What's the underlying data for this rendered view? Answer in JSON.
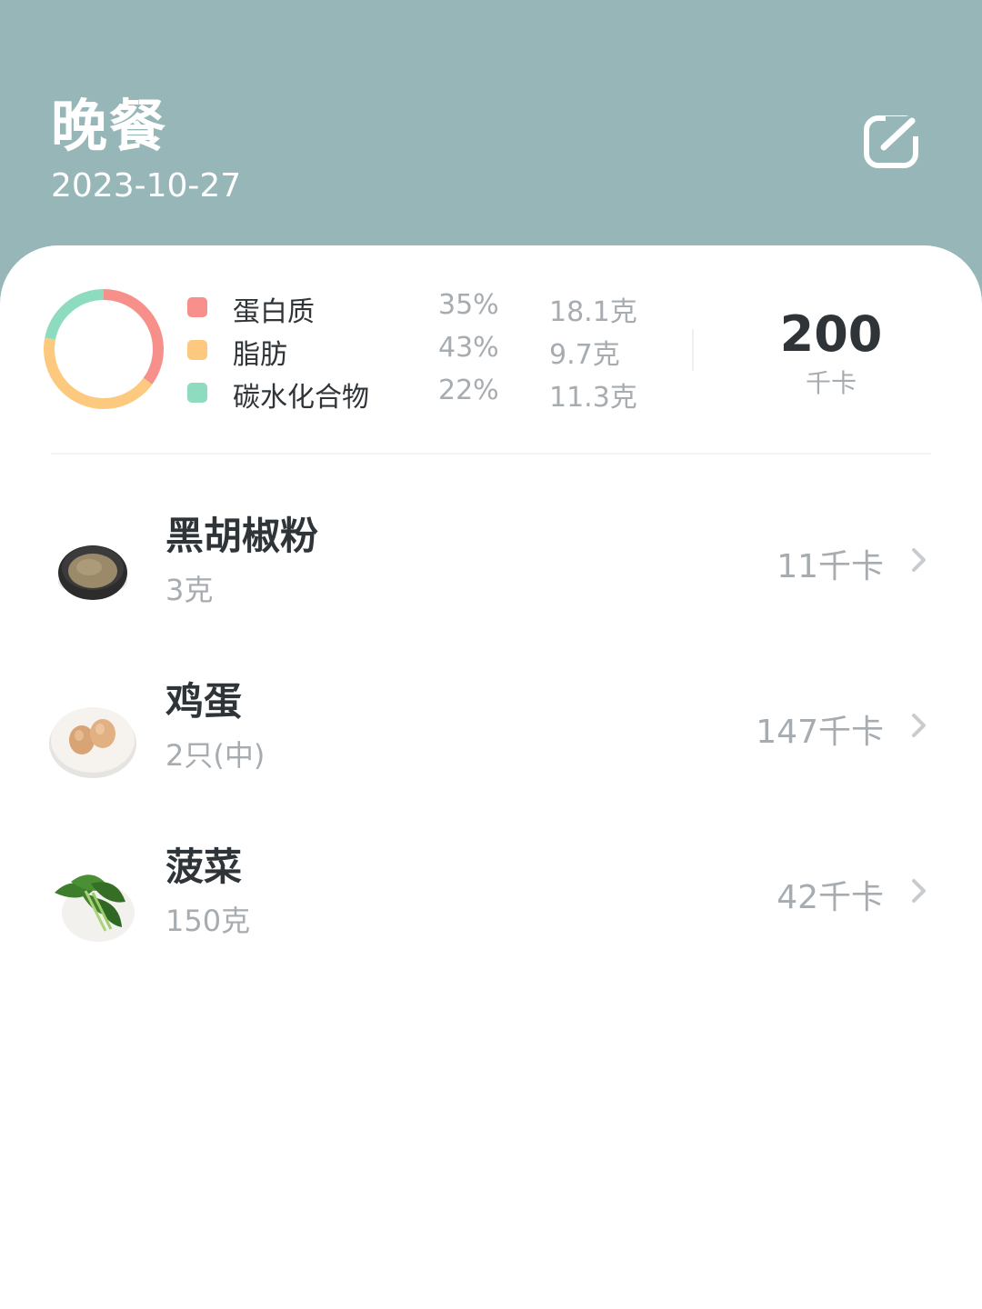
{
  "header": {
    "title": "晚餐",
    "date": "2023-10-27",
    "bg_color": "#96b6b7",
    "edit_icon": "edit-icon"
  },
  "summary": {
    "macros": [
      {
        "name": "蛋白质",
        "percent": "35%",
        "grams": "18.1克",
        "color": "#f7908a"
      },
      {
        "name": "脂肪",
        "percent": "43%",
        "grams": "9.7克",
        "color": "#fcc97e"
      },
      {
        "name": "碳水化合物",
        "percent": "22%",
        "grams": "11.3克",
        "color": "#8ddcc0"
      }
    ],
    "total_kcal": "200",
    "kcal_unit": "千卡"
  },
  "foods": [
    {
      "name": "黑胡椒粉",
      "amount": "3克",
      "kcal": "11千卡",
      "icon": "black-pepper-powder-bowl"
    },
    {
      "name": "鸡蛋",
      "amount": "2只(中)",
      "kcal": "147千卡",
      "icon": "eggs-on-plate"
    },
    {
      "name": "菠菜",
      "amount": "150克",
      "kcal": "42千卡",
      "icon": "spinach-on-plate"
    }
  ]
}
